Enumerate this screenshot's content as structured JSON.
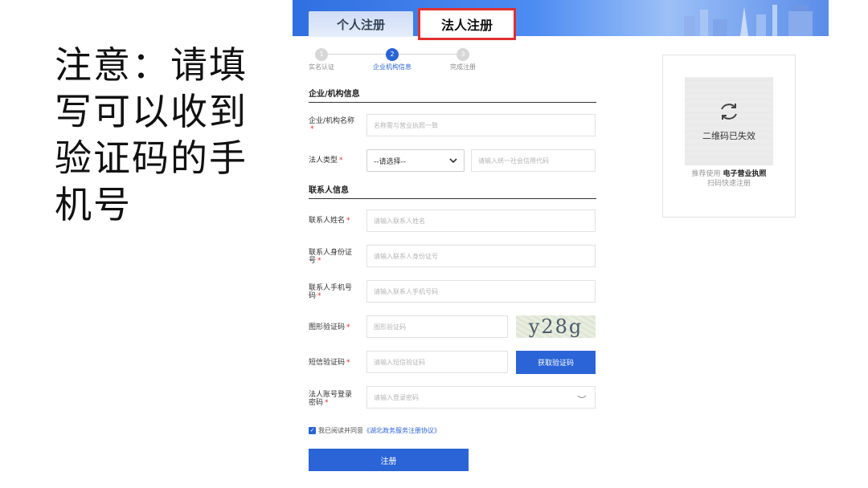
{
  "note": "注意：请填写可以收到验证码的手机号",
  "tabs": {
    "personal": "个人注册",
    "legal": "法人注册"
  },
  "steps": [
    {
      "num": "1",
      "label": "实名认证"
    },
    {
      "num": "2",
      "label": "企业机构信息"
    },
    {
      "num": "3",
      "label": "完成注册"
    }
  ],
  "sections": {
    "org": "企业/机构信息",
    "contact": "联系人信息"
  },
  "fields": {
    "org_name": {
      "label": "企业/机构名称",
      "placeholder": "名称需与营业执照一致"
    },
    "legal_type": {
      "label": "法人类型",
      "selected": "--请选择--",
      "placeholder": "请输入统一社会信用代码"
    },
    "contact_name": {
      "label": "联系人姓名",
      "placeholder": "请输入联系人姓名"
    },
    "contact_id": {
      "label": "联系人身份证号",
      "placeholder": "请输入联系人身份证号"
    },
    "contact_phone": {
      "label": "联系人手机号码",
      "placeholder": "请输入联系人手机号码"
    },
    "image_code": {
      "label": "图形验证码",
      "placeholder": "图形验证码",
      "captcha": "y28g"
    },
    "sms_code": {
      "label": "短信验证码",
      "placeholder": "请输入短信验证码",
      "button": "获取验证码"
    },
    "password": {
      "label": "法人账号登录密码",
      "placeholder": "请输入登录密码"
    }
  },
  "agreement": {
    "prefix": "我已阅读并同意",
    "link": "《湖北政务服务注册协议》"
  },
  "register_button": "注册",
  "qr": {
    "status": "二维码已失效",
    "caption_prefix": "推荐使用",
    "caption_bold": "电子营业执照",
    "caption_line2": "扫码快速注册"
  },
  "colors": {
    "primary": "#2a64d6",
    "highlight": "#e0302e"
  }
}
